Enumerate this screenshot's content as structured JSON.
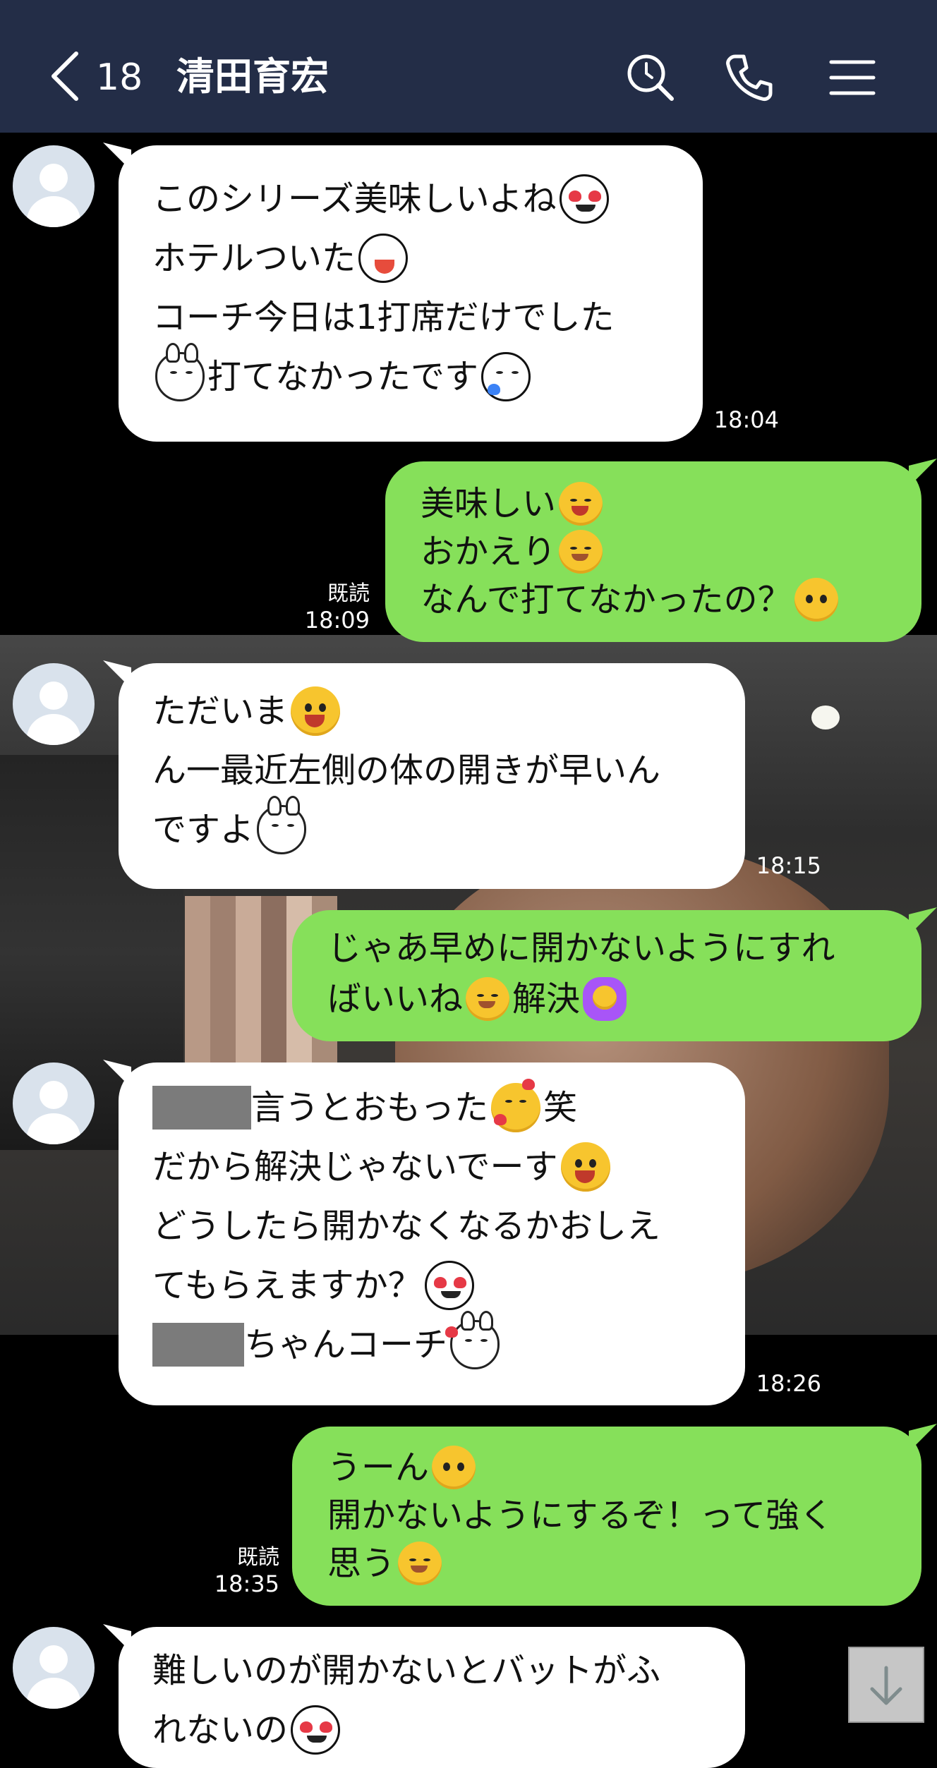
{
  "header": {
    "unread_count": "18",
    "chat_title": "清田育宏"
  },
  "messages": [
    {
      "id": "m1",
      "direction": "in",
      "time": "18:04",
      "lines": [
        {
          "text": "このシリーズ美味しいよね",
          "after": "heart-eyes-icon"
        },
        {
          "text": "ホテルついた",
          "after": "laughing-icon"
        },
        {
          "text": "コーチ今日は1打席だけでした"
        },
        {
          "before": "bunny-icon",
          "text": "打てなかったです",
          "after": "sleepy-icon"
        }
      ]
    },
    {
      "id": "m2",
      "direction": "out",
      "read": "既読",
      "time": "18:09",
      "lines": [
        {
          "text": "美味しい",
          "after": "yum-icon"
        },
        {
          "text": "おかえり",
          "after": "smile-icon"
        },
        {
          "text": "なんで打てなかったの？",
          "after": "thinking-icon"
        }
      ]
    },
    {
      "id": "m3",
      "direction": "in",
      "time": "18:15",
      "lines": [
        {
          "text": "ただいま",
          "after": "grin-icon"
        },
        {
          "text": "ん一最近左側の体の開きが早いん"
        },
        {
          "text": "ですよ",
          "after": "bunny-icon"
        }
      ]
    },
    {
      "id": "m4",
      "direction": "out",
      "lines": [
        {
          "text": "じゃあ早めに開かないようにすれ"
        },
        {
          "text": "ばいいね",
          "mid": "smile-icon",
          "text2": "解決",
          "after": "ok-gesture-icon"
        }
      ]
    },
    {
      "id": "m5",
      "direction": "in",
      "time": "18:26",
      "lines": [
        {
          "redacted": true,
          "text": "言うとおもった",
          "mid": "hearts-face-icon",
          "text2": "笑"
        },
        {
          "text": "だから解決じゃないでーす",
          "after": "grin-icon"
        },
        {
          "text": "どうしたら開かなくなるかおしえ"
        },
        {
          "text": "てもらえますか？",
          "after": "heart-eyes-icon"
        },
        {
          "redacted": true,
          "text": "ちゃんコーチ",
          "after": "bunny-kiss-icon"
        }
      ]
    },
    {
      "id": "m6",
      "direction": "out",
      "read": "既読",
      "time": "18:35",
      "lines": [
        {
          "text": "うーん",
          "after": "thinking-icon"
        },
        {
          "text": "開かないようにするぞ！って強く"
        },
        {
          "text": "思う",
          "after": "smile-icon"
        }
      ]
    },
    {
      "id": "m7",
      "direction": "in",
      "lines": [
        {
          "text": "難しいのが開かないとバットがふ"
        },
        {
          "text": "れないの",
          "after": "heart-eyes-icon"
        }
      ]
    }
  ],
  "icons": {
    "back": "chevron-left-icon",
    "search": "search-icon",
    "call": "phone-icon",
    "menu": "hamburger-menu-icon",
    "scroll": "arrow-down-icon"
  },
  "colors": {
    "header_bg": "#232d47",
    "outgoing_bubble": "#86e05a",
    "incoming_bubble": "#ffffff",
    "chat_bg": "#000000"
  }
}
